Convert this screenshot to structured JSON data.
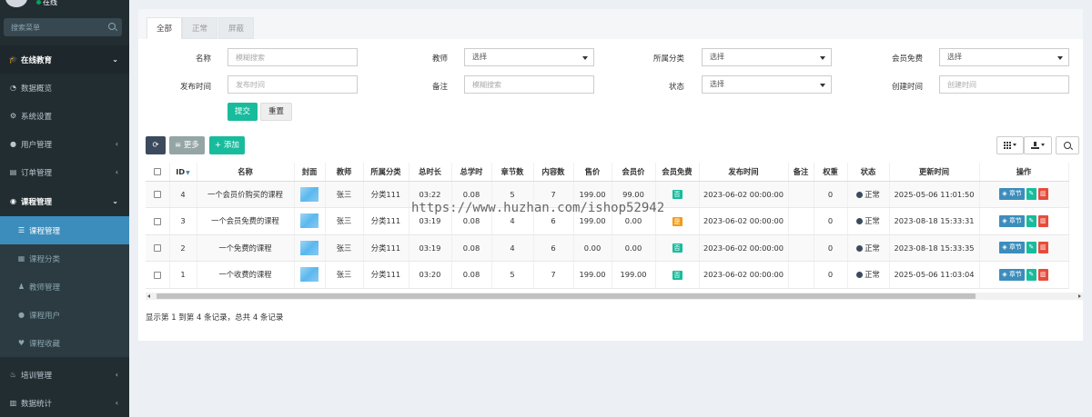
{
  "sidebar": {
    "status": "在线",
    "search_placeholder": "搜索菜单",
    "header": {
      "label": "在线教育",
      "icon": "graduation-cap-icon"
    },
    "items": [
      {
        "label": "数据概览",
        "icon": "dashboard-icon"
      },
      {
        "label": "系统设置",
        "icon": "cogs-icon"
      },
      {
        "label": "用户管理",
        "icon": "user-icon"
      },
      {
        "label": "订单管理",
        "icon": "order-icon"
      },
      {
        "label": "课程管理",
        "icon": "circle-icon"
      },
      {
        "label": "课程管理",
        "icon": "list-icon"
      },
      {
        "label": "课程分类",
        "icon": "th-icon"
      },
      {
        "label": "教师管理",
        "icon": "teacher-icon"
      },
      {
        "label": "课程用户",
        "icon": "user-icon"
      },
      {
        "label": "课程收藏",
        "icon": "heart-icon"
      },
      {
        "label": "培训管理",
        "icon": "fire-icon"
      },
      {
        "label": "数据统计",
        "icon": "bar-chart-icon"
      }
    ]
  },
  "tabs": [
    "全部",
    "正常",
    "屏蔽"
  ],
  "filters": {
    "name": {
      "label": "名称",
      "placeholder": "模糊搜索"
    },
    "teacher": {
      "label": "教师",
      "value": "选择"
    },
    "category": {
      "label": "所属分类",
      "value": "选择"
    },
    "member_free": {
      "label": "会员免费",
      "value": "选择"
    },
    "publish_time": {
      "label": "发布时间",
      "placeholder": "发布时间"
    },
    "remark": {
      "label": "备注",
      "placeholder": "模糊搜索"
    },
    "status": {
      "label": "状态",
      "value": "选择"
    },
    "create_time": {
      "label": "创建时间",
      "placeholder": "创建时间"
    },
    "submit": "提交",
    "reset": "重置"
  },
  "toolbar": {
    "more": "更多",
    "add": "添加"
  },
  "table": {
    "columns": [
      "ID",
      "名称",
      "封面",
      "教师",
      "所属分类",
      "总时长",
      "总学时",
      "章节数",
      "内容数",
      "售价",
      "会员价",
      "会员免费",
      "发布时间",
      "备注",
      "权重",
      "状态",
      "更新时间",
      "操作"
    ],
    "rows": [
      {
        "id": "4",
        "name": "一个会员价购买的课程",
        "teacher": "张三",
        "category": "分类111",
        "duration": "03:22",
        "hours": "0.08",
        "chapters": "5",
        "contents": "7",
        "price": "199.00",
        "member_price": "99.00",
        "member_free": "否",
        "publish": "2023-06-02 00:00:00",
        "remark": "",
        "weight": "0",
        "status": "正常",
        "updated": "2025-05-06 11:01:50"
      },
      {
        "id": "3",
        "name": "一个会员免费的课程",
        "teacher": "张三",
        "category": "分类111",
        "duration": "03:19",
        "hours": "0.08",
        "chapters": "4",
        "contents": "6",
        "price": "199.00",
        "member_price": "0.00",
        "member_free": "是",
        "publish": "2023-06-02 00:00:00",
        "remark": "",
        "weight": "0",
        "status": "正常",
        "updated": "2023-08-18 15:33:31"
      },
      {
        "id": "2",
        "name": "一个免费的课程",
        "teacher": "张三",
        "category": "分类111",
        "duration": "03:19",
        "hours": "0.08",
        "chapters": "4",
        "contents": "6",
        "price": "0.00",
        "member_price": "0.00",
        "member_free": "否",
        "publish": "2023-06-02 00:00:00",
        "remark": "",
        "weight": "0",
        "status": "正常",
        "updated": "2023-08-18 15:33:35"
      },
      {
        "id": "1",
        "name": "一个收费的课程",
        "teacher": "张三",
        "category": "分类111",
        "duration": "03:20",
        "hours": "0.08",
        "chapters": "5",
        "contents": "7",
        "price": "199.00",
        "member_price": "199.00",
        "member_free": "否",
        "publish": "2023-06-02 00:00:00",
        "remark": "",
        "weight": "0",
        "status": "正常",
        "updated": "2025-05-06 11:03:04"
      }
    ],
    "op_chapter": "章节"
  },
  "footer": "显示第 1 到第 4 条记录，总共 4 条记录",
  "watermark": "https://www.huzhan.com/ishop52942",
  "colors": {
    "sidebar_bg": "#222d32",
    "active": "#3c8dbc",
    "success": "#18bc9c",
    "danger": "#e74c3c",
    "warning": "#f39c12"
  }
}
